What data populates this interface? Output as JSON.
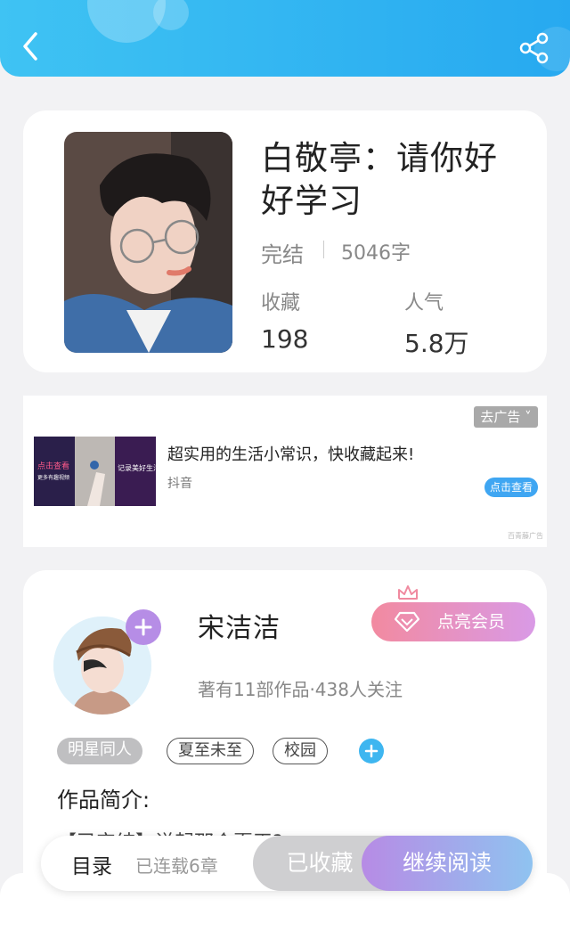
{
  "header": {
    "back_icon": "chevron-left-icon",
    "share_icon": "share-icon"
  },
  "book": {
    "title": "白敬亭：请你好好学习",
    "status": "完结",
    "word_count": "5046字",
    "collect_label": "收藏",
    "collect_value": "198",
    "popularity_label": "人气",
    "popularity_value": "5.8万"
  },
  "ad": {
    "close_label": "去广告",
    "image_text_left": "点击查看",
    "image_text_left_sub": "更多有趣视频",
    "image_text_right": "记录美好生活",
    "title": "超实用的生活小常识，快收藏起来!",
    "source": "抖音",
    "cta": "点击查看",
    "footnote": "百青藤广告"
  },
  "author": {
    "name": "宋洁洁",
    "vip_button": "点亮会员",
    "meta": "著有11部作品·438人关注",
    "tags": [
      "明星同人",
      "夏至未至",
      "校园"
    ],
    "intro_label": "作品简介:",
    "intro_preview": "【已完结】说起那个夏天?"
  },
  "bottom_bar": {
    "toc_label": "目录",
    "serial_status": "已连载6章",
    "collected_label": "已收藏",
    "read_label": "继续阅读"
  },
  "colors": {
    "header_gradient": [
      "#3fc3f3",
      "#27a9f0"
    ],
    "vip_gradient": [
      "#f28aa0",
      "#d99ae6"
    ],
    "read_gradient": [
      "#b78be5",
      "#8fc3f0"
    ],
    "accent_blue": "#3eb6f0"
  }
}
